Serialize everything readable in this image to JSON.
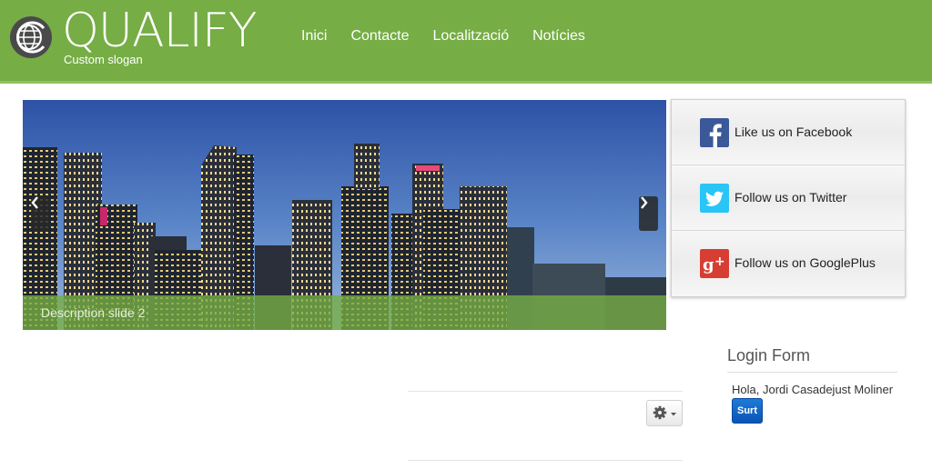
{
  "header": {
    "logo_text": "QUALIFY",
    "slogan": "Custom slogan",
    "brand_color": "#76ad45",
    "nav": [
      {
        "label": "Inici"
      },
      {
        "label": "Contacte"
      },
      {
        "label": "Localització"
      },
      {
        "label": "Notícies"
      }
    ]
  },
  "slider": {
    "caption": "Description slide 2",
    "prev_icon": "chevron-left-icon",
    "next_icon": "chevron-right-icon"
  },
  "social": {
    "items": [
      {
        "label": "Like us on Facebook",
        "icon": "facebook-icon",
        "color": "#3b5998"
      },
      {
        "label": "Follow us on Twitter",
        "icon": "twitter-icon",
        "color": "#29c5f6"
      },
      {
        "label": "Follow us on GooglePlus",
        "icon": "googleplus-icon",
        "color": "#d73d32"
      }
    ]
  },
  "content": {
    "gear_icon": "gear-icon"
  },
  "login": {
    "title": "Login Form",
    "greeting": "Hola, Jordi Casadejust Moliner",
    "logout_label": "Surt",
    "button_color": "#0a55b5"
  }
}
